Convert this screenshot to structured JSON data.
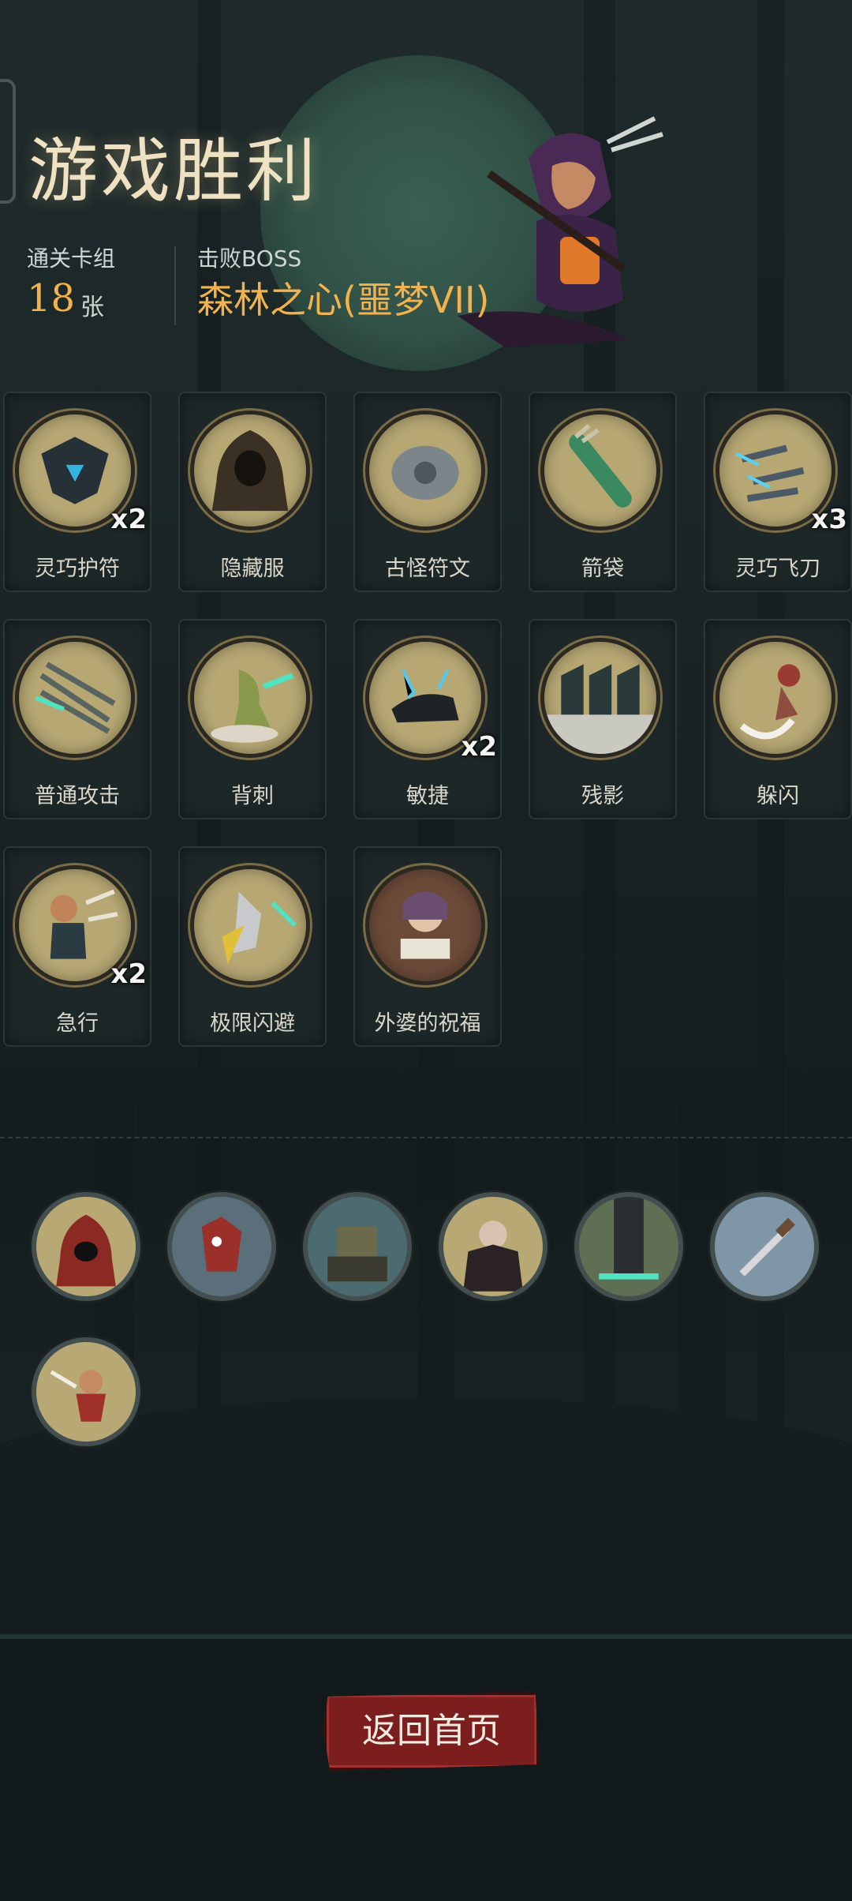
{
  "header": {
    "title": "游戏胜利",
    "deck_label": "通关卡组",
    "deck_count": "18",
    "deck_unit": "张",
    "boss_label": "击败BOSS",
    "boss_name": "森林之心(噩梦VII)"
  },
  "cards": [
    {
      "label": "灵巧护符",
      "mult": "x2",
      "icon": "amulet-icon"
    },
    {
      "label": "隐藏服",
      "mult": "",
      "icon": "hooded-cloak-icon"
    },
    {
      "label": "古怪符文",
      "mult": "",
      "icon": "rune-stone-icon"
    },
    {
      "label": "箭袋",
      "mult": "",
      "icon": "quiver-icon"
    },
    {
      "label": "灵巧飞刀",
      "mult": "x3",
      "icon": "throwing-knives-icon"
    },
    {
      "label": "普通攻击",
      "mult": "",
      "icon": "arrows-attack-icon"
    },
    {
      "label": "背刺",
      "mult": "",
      "icon": "backstab-icon"
    },
    {
      "label": "敏捷",
      "mult": "x2",
      "icon": "panther-icon"
    },
    {
      "label": "残影",
      "mult": "",
      "icon": "afterimage-icon"
    },
    {
      "label": "躲闪",
      "mult": "",
      "icon": "dodge-icon"
    },
    {
      "label": "急行",
      "mult": "x2",
      "icon": "dash-icon"
    },
    {
      "label": "极限闪避",
      "mult": "",
      "icon": "extreme-dodge-icon"
    },
    {
      "label": "外婆的祝福",
      "mult": "",
      "icon": "grandma-blessing-icon"
    }
  ],
  "relics": [
    {
      "icon": "hooded-mage-icon"
    },
    {
      "icon": "red-beast-icon"
    },
    {
      "icon": "treasure-golem-icon"
    },
    {
      "icon": "vampire-icon"
    },
    {
      "icon": "dark-pillar-icon"
    },
    {
      "icon": "dagger-icon"
    },
    {
      "icon": "falling-hero-icon"
    }
  ],
  "footer": {
    "home_button": "返回首页"
  },
  "colors": {
    "accent_gold": "#f2b24d",
    "title": "#efe2c2",
    "button_red": "#7c1e1e"
  }
}
